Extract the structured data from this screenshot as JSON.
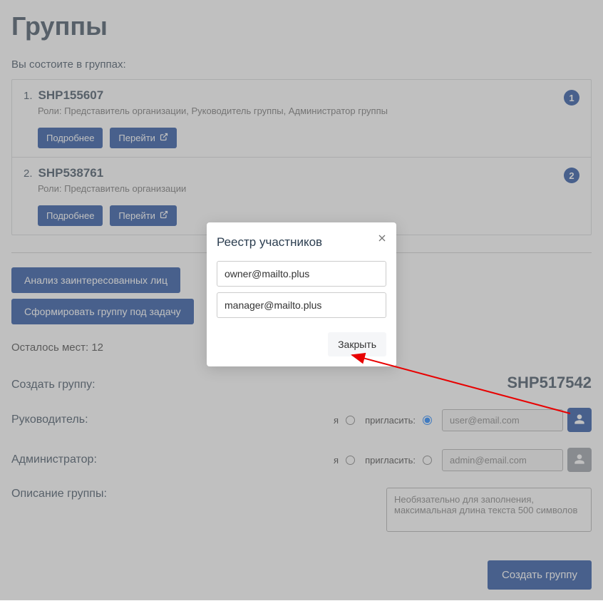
{
  "page_title": "Группы",
  "subtitle": "Вы состоите в группах:",
  "groups": [
    {
      "num": "1.",
      "name": "SHP155607",
      "roles": "Роли: Представитель организации, Руководитель группы, Администратор группы",
      "badge": "1"
    },
    {
      "num": "2.",
      "name": "SHP538761",
      "roles": "Роли: Представитель организации",
      "badge": "2"
    }
  ],
  "buttons": {
    "more": "Подробнее",
    "go": "Перейти",
    "analysis": "Анализ заинтересованных лиц",
    "form_group": "Сформировать группу под задачу",
    "create_group": "Создать группу"
  },
  "remaining_label": "Осталось мест: 12",
  "create_label": "Создать группу:",
  "group_code": "SHP517542",
  "manager_label": "Руководитель:",
  "admin_label": "Администратор:",
  "desc_label": "Описание группы:",
  "radio": {
    "me": "я",
    "invite": "пригласить:"
  },
  "inputs": {
    "manager_placeholder": "user@email.com",
    "admin_placeholder": "admin@email.com",
    "desc_placeholder": "Необязательно для заполнения, максимальная длина текста 500 символов"
  },
  "modal": {
    "title": "Реестр участников",
    "participants": [
      "owner@mailto.plus",
      "manager@mailto.plus"
    ],
    "close_label": "Закрыть"
  }
}
